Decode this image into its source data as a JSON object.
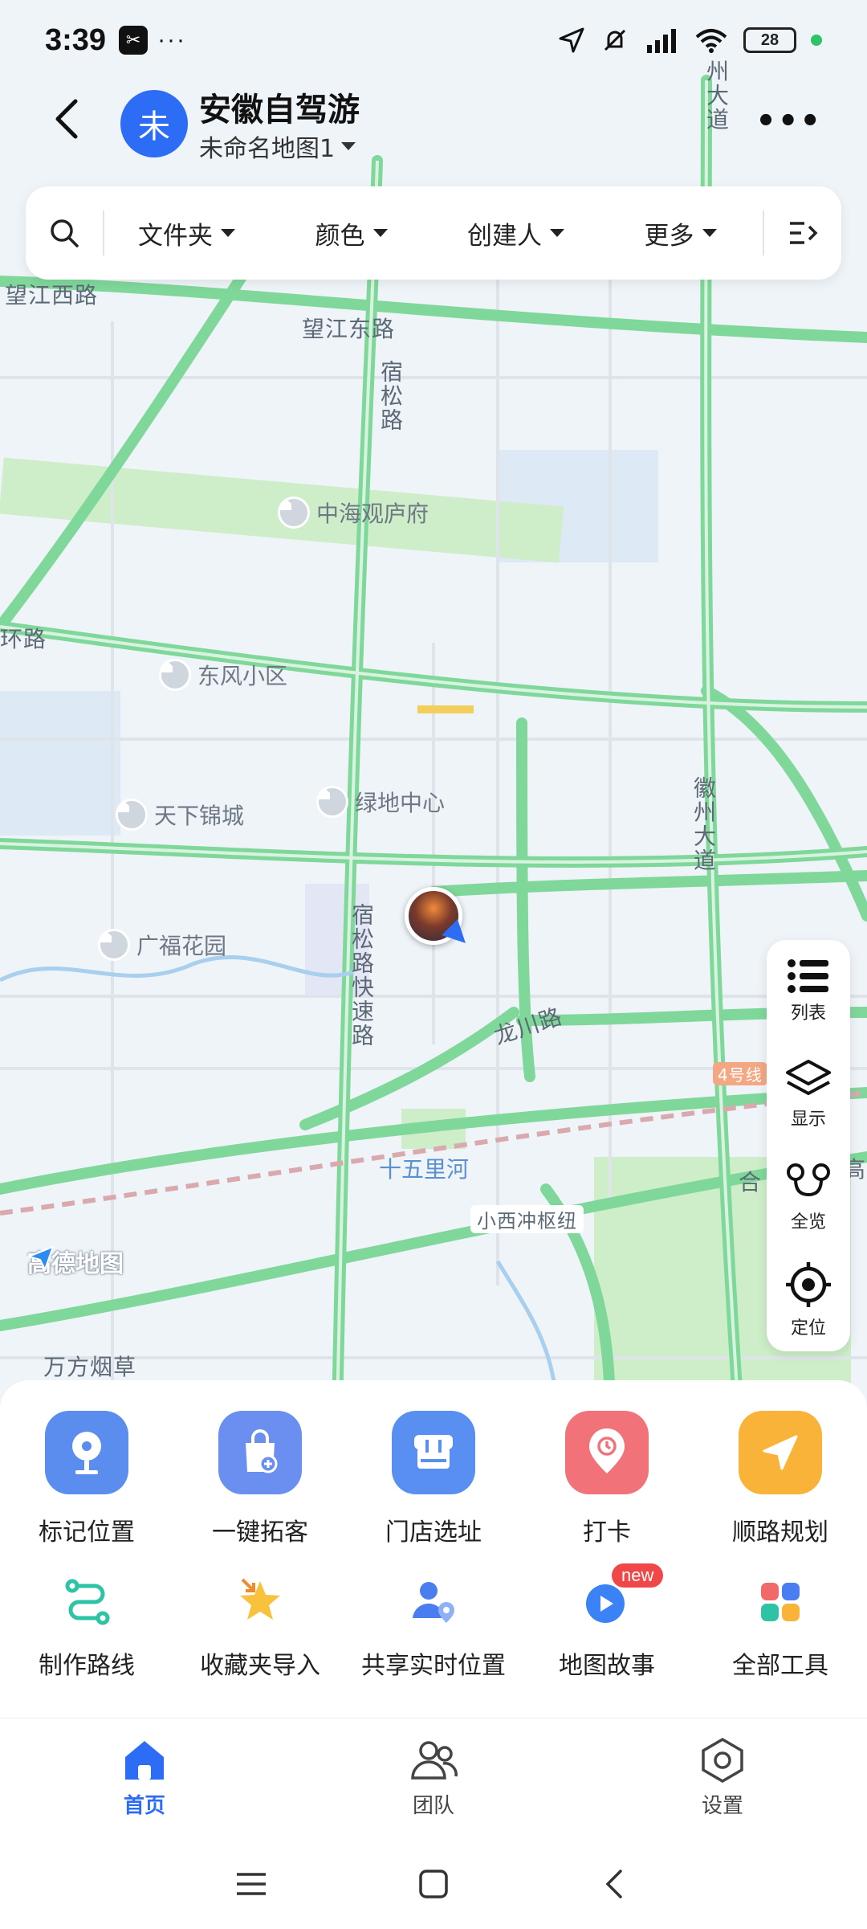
{
  "status_bar": {
    "time": "3:39",
    "battery": "28",
    "notif_dots": "···"
  },
  "header": {
    "avatar_char": "未",
    "title": "安徽自驾游",
    "subtitle": "未命名地图1"
  },
  "filter_bar": {
    "items": [
      "文件夹",
      "颜色",
      "创建人",
      "更多"
    ]
  },
  "map": {
    "roads": [
      "望江西路",
      "望江东路",
      "宿松路",
      "州大道",
      "环路",
      "徽州大道",
      "宿松路快速路",
      "龙川路",
      "4号线",
      "小西冲枢纽",
      "合",
      "高",
      "万方烟草"
    ],
    "pois": [
      "中海观庐府",
      "东风小区",
      "天下锦城",
      "绿地中心",
      "广福花园"
    ],
    "river": "十五里河",
    "brand": "高德地图"
  },
  "right_panel": {
    "items": [
      "列表",
      "显示",
      "全览",
      "定位"
    ]
  },
  "tools": {
    "row1": [
      "标记位置",
      "一键拓客",
      "门店选址",
      "打卡",
      "顺路规划"
    ],
    "row2": [
      "制作路线",
      "收藏夹导入",
      "共享实时位置",
      "地图故事",
      "全部工具"
    ],
    "new_badge": "new"
  },
  "tabs": [
    "首页",
    "团队",
    "设置"
  ],
  "colors": {
    "accent": "#2d6df6",
    "road": "#7fd89a",
    "map_bg": "#eef4f8"
  }
}
